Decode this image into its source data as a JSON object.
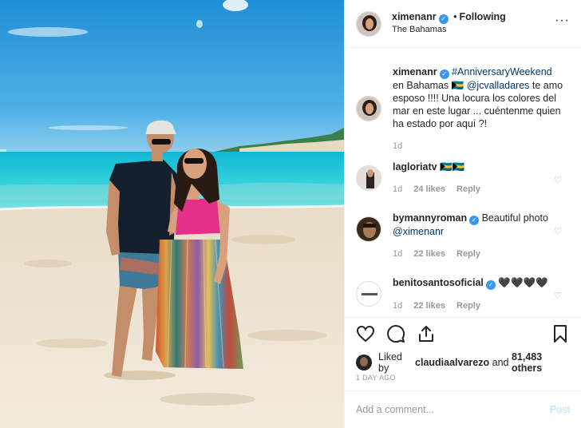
{
  "colors": {
    "accent": "#3897f0",
    "link": "#003569",
    "muted": "#999999",
    "post_disabled": "#b2dffc"
  },
  "header": {
    "username": "ximenanr",
    "verified": true,
    "separator": "•",
    "follow_status": "Following",
    "location": "The Bahamas",
    "more_icon": "ellipsis-icon",
    "more_label": "···"
  },
  "caption": {
    "username": "ximenanr",
    "hashtag": "#AnniversaryWeekend",
    "text_before_mention": "en Bahamas 🇧🇸",
    "mention": "@jcvalladares",
    "text_after_mention": "te amo esposo !!!! Una locura los colores del mar en este lugar ... cuéntenme quien ha estado por aquí ?!",
    "age": "1d"
  },
  "comments": [
    {
      "username": "lagloriatv",
      "verified": false,
      "text": "🇧🇸🇧🇸",
      "age": "1d",
      "likes": "24 likes",
      "reply": "Reply"
    },
    {
      "username": "bymannyroman",
      "verified": true,
      "text": "Beautiful photo",
      "mention": "@ximenanr",
      "age": "1d",
      "likes": "22 likes",
      "reply": "Reply"
    },
    {
      "username": "benitosantosoficial",
      "verified": true,
      "text": "🖤🖤🖤🖤",
      "age": "1d",
      "likes": "22 likes",
      "reply": "Reply"
    }
  ],
  "actions": {
    "like_icon": "heart-icon",
    "comment_icon": "comment-icon",
    "share_icon": "share-icon",
    "save_icon": "bookmark-icon"
  },
  "likes": {
    "prefix": "Liked by",
    "user": "claudiaalvarezo",
    "middle": "and",
    "count": "81,483 others"
  },
  "timestamp": "1 DAY AGO",
  "add_comment": {
    "placeholder": "Add a comment...",
    "post_label": "Post"
  }
}
